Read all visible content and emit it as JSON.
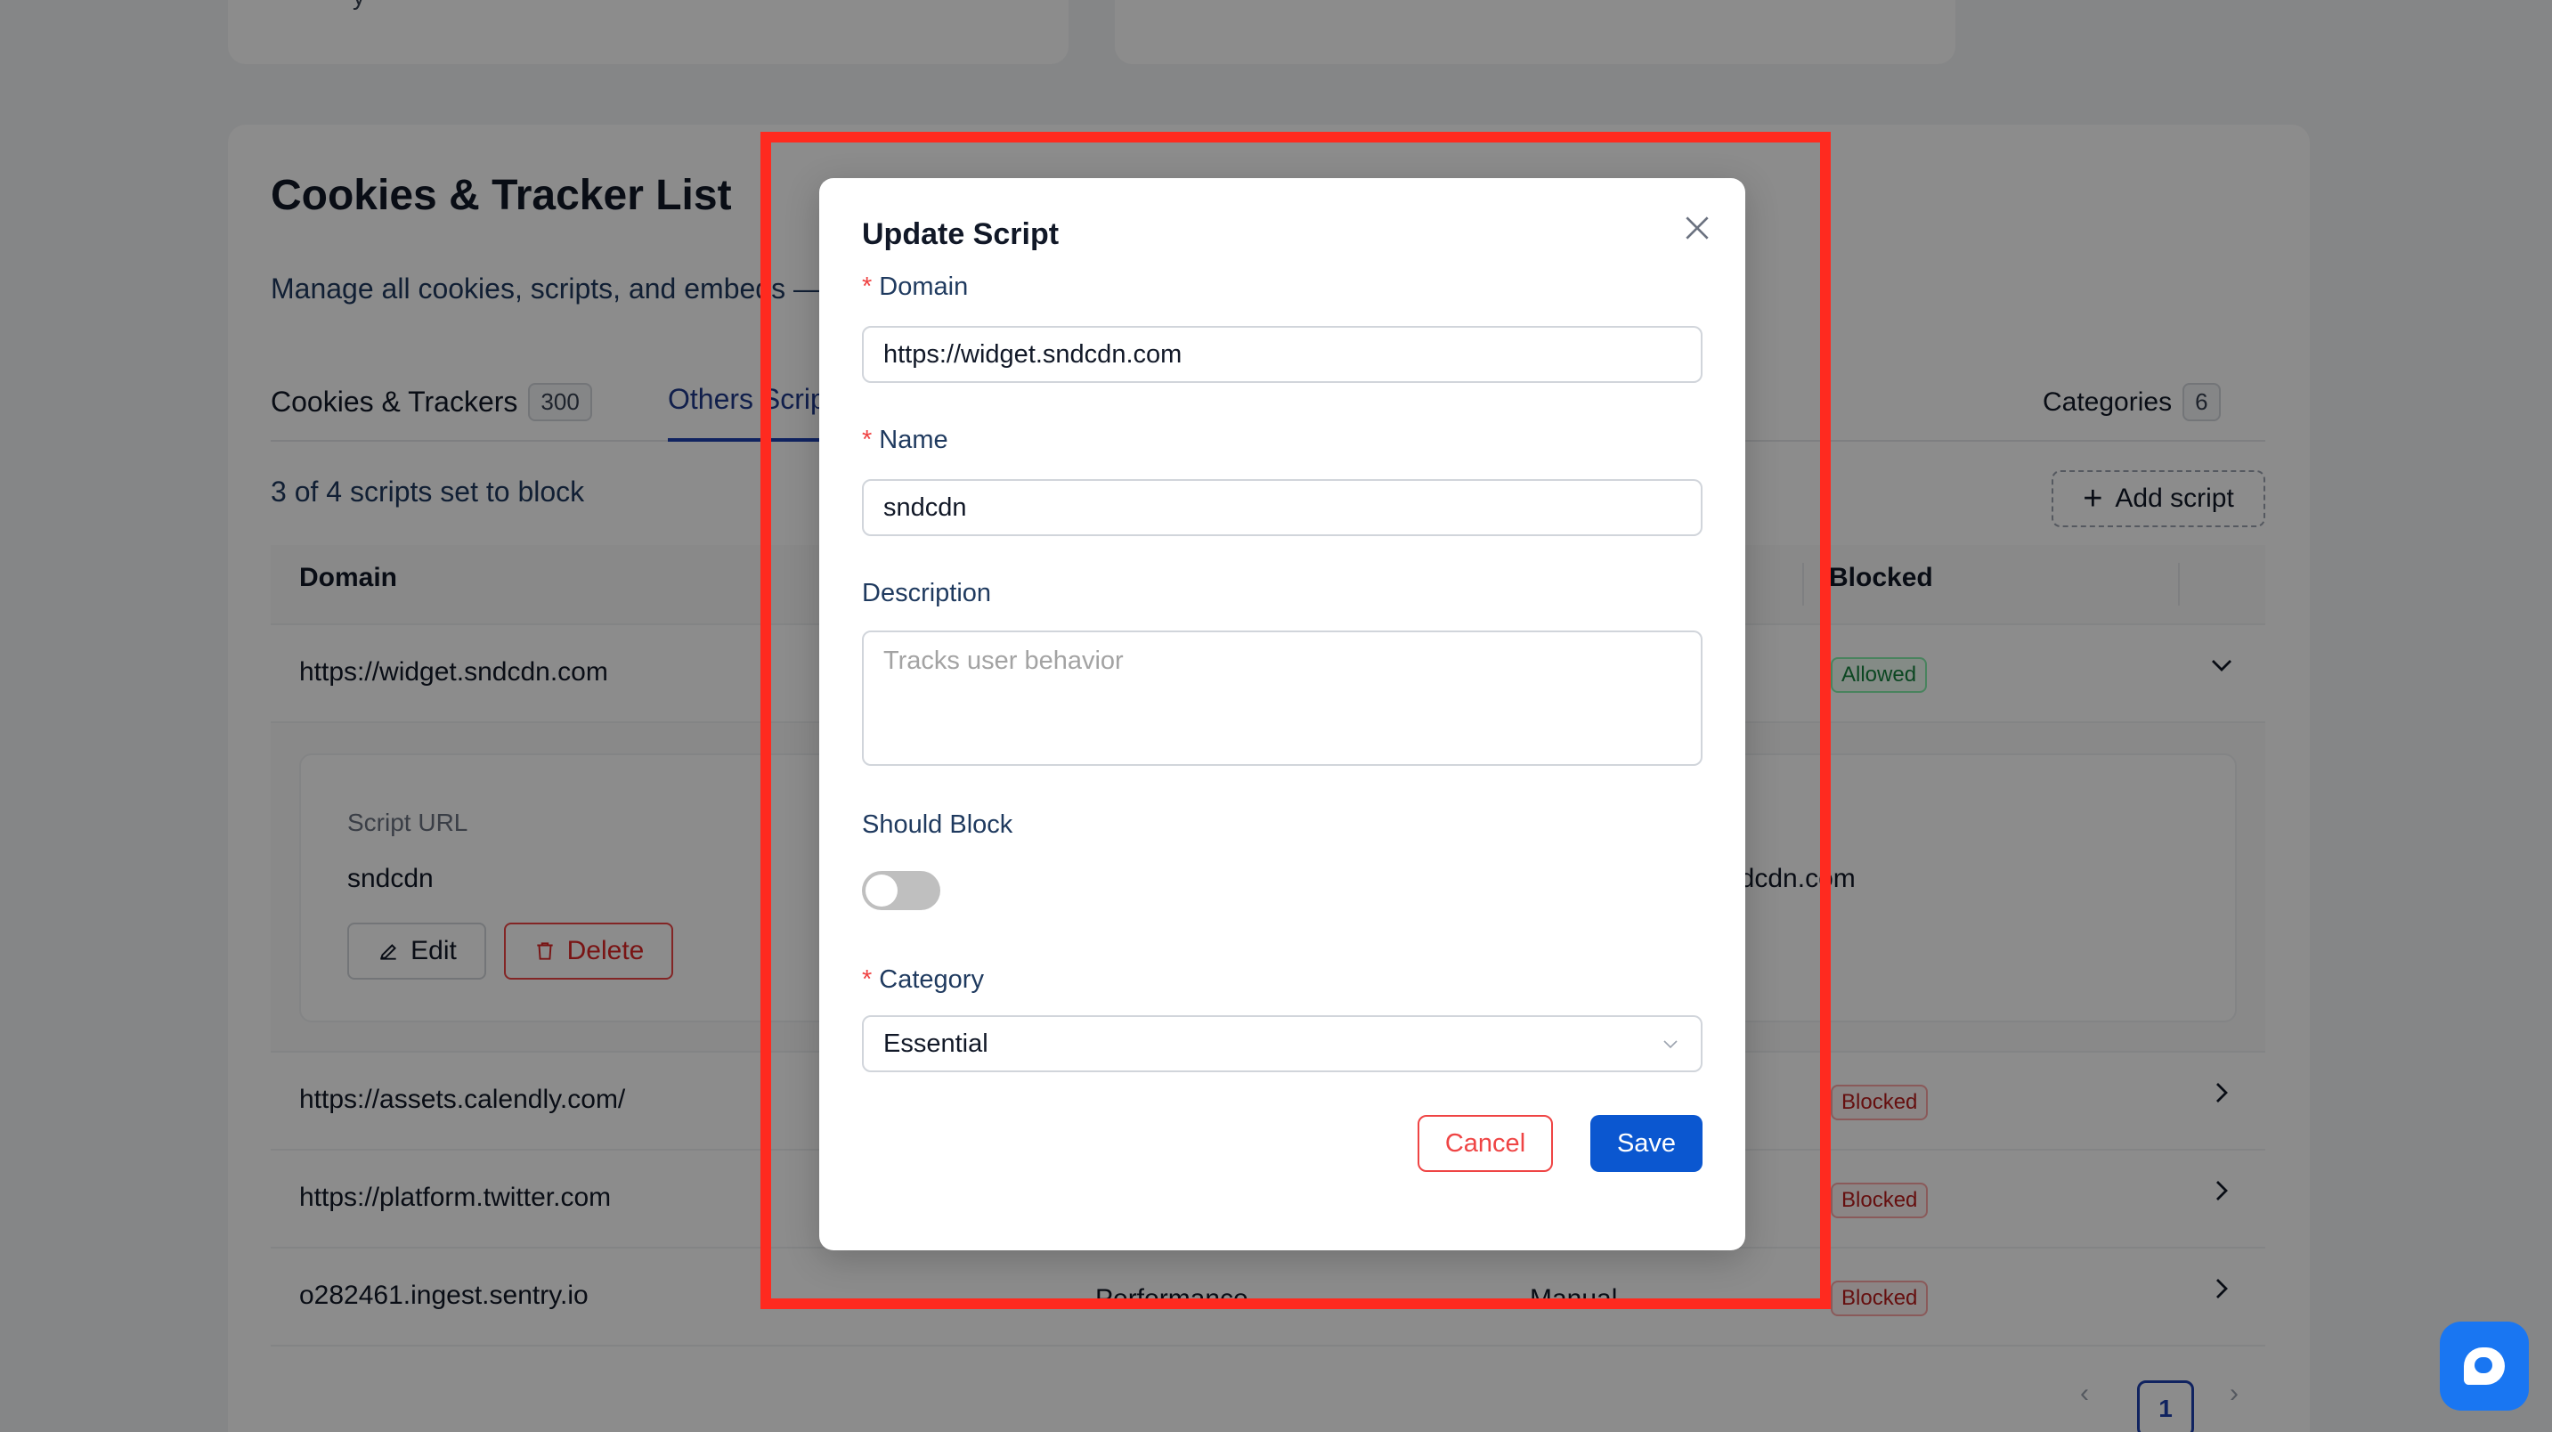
{
  "background": {
    "top_card_partial": "y",
    "title": "Cookies & Tracker List",
    "subtitle": "Manage all cookies, scripts, and embeds —",
    "tabs": [
      {
        "label": "Cookies & Trackers",
        "count": "300"
      },
      {
        "label": "Others Scripts",
        "count": ""
      },
      {
        "label": "Categories",
        "count": "6"
      }
    ],
    "scripts_count": "3 of 4 scripts set to block",
    "add_script_label": "Add script",
    "table": {
      "col_domain": "Domain",
      "col_blocked": "Blocked",
      "rows": [
        {
          "domain": "https://widget.sndcdn.com",
          "category": "",
          "type": "",
          "status": "Allowed"
        },
        {
          "domain": "https://assets.calendly.com/",
          "category": "",
          "type": "",
          "status": "Blocked"
        },
        {
          "domain": "https://platform.twitter.com",
          "category": "",
          "type": "",
          "status": "Blocked"
        },
        {
          "domain": "o282461.ingest.sentry.io",
          "category": "Performance",
          "type": "Manual",
          "status": "Blocked"
        }
      ]
    },
    "expanded": {
      "script_url_label": "Script URL",
      "name_value": "sndcdn",
      "domain_value_partial": "sndcdn.com",
      "edit_label": "Edit",
      "delete_label": "Delete"
    },
    "pagination": {
      "current": "1",
      "prev": "‹",
      "next": "›"
    }
  },
  "modal": {
    "title": "Update Script",
    "close_glyph": "✕",
    "domain": {
      "label": "Domain",
      "value": "https://widget.sndcdn.com"
    },
    "name": {
      "label": "Name",
      "value": "sndcdn"
    },
    "description": {
      "label": "Description",
      "placeholder": "Tracks user behavior",
      "value": ""
    },
    "should_block": {
      "label": "Should Block",
      "on": false
    },
    "category": {
      "label": "Category",
      "value": "Essential"
    },
    "cancel_label": "Cancel",
    "save_label": "Save"
  },
  "colors": {
    "highlight": "#ff2a1f",
    "primary": "#0b57d0",
    "danger": "#ef4444",
    "chat": "#1976f2"
  },
  "icons": [
    "close-icon",
    "plus-icon",
    "chevron-down-icon",
    "chevron-right-icon",
    "edit-icon",
    "trash-icon",
    "select-arrow-icon",
    "chat-icon"
  ]
}
